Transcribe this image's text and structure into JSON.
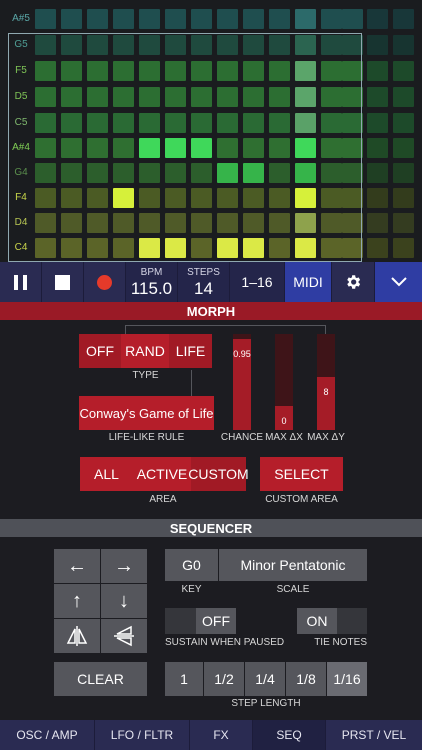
{
  "grid": {
    "note_labels": [
      {
        "text": "A#5",
        "color": "#5aa7a7"
      },
      {
        "text": "G5",
        "color": "#4f9e95"
      },
      {
        "text": "F5",
        "color": "#7fc456"
      },
      {
        "text": "D5",
        "color": "#7fc456"
      },
      {
        "text": "C5",
        "color": "#7fb86e"
      },
      {
        "text": "A#4",
        "color": "#7fcd54"
      },
      {
        "text": "G4",
        "color": "#5b8f4d"
      },
      {
        "text": "F4",
        "color": "#c8d64a"
      },
      {
        "text": "D4",
        "color": "#b7c553"
      },
      {
        "text": "C4",
        "color": "#c9d44b"
      }
    ],
    "row_colors": [
      {
        "base": "#1f4e4f",
        "hi": "#2c6a6a",
        "dim": "#183739"
      },
      {
        "base": "#1f4a3e",
        "hi": "#2b6450",
        "dim": "#173430"
      },
      {
        "base": "#2c6e32",
        "hi": "#5ba56a",
        "dim": "#1d4a2a"
      },
      {
        "base": "#2c6e32",
        "hi": "#5ba56a",
        "dim": "#1d4a2a"
      },
      {
        "base": "#2a6a34",
        "hi": "#5aa168",
        "dim": "#1d4a2a"
      },
      {
        "base": "#2f6f31",
        "hi": "#3fd85a",
        "dim": "#1f4a26"
      },
      {
        "base": "#2c5e2c",
        "hi": "#36b44a",
        "dim": "#1f3f23"
      },
      {
        "base": "#4b5b24",
        "hi": "#d6f03a",
        "dim": "#333c1c"
      },
      {
        "base": "#4f5a28",
        "hi": "#8ea24c",
        "dim": "#343c20"
      },
      {
        "base": "#5b6428",
        "hi": "#dbe946",
        "dim": "#3b421d"
      }
    ],
    "active_cells": [
      [
        5,
        4
      ],
      [
        5,
        5
      ],
      [
        5,
        6
      ],
      [
        6,
        7
      ],
      [
        6,
        8
      ],
      [
        7,
        3
      ],
      [
        9,
        4
      ],
      [
        9,
        5
      ],
      [
        9,
        7
      ],
      [
        9,
        8
      ]
    ],
    "highlight_column": 10
  },
  "transport": {
    "bpm_label": "BPM",
    "bpm_value": "115.0",
    "steps_label": "STEPS",
    "steps_value": "14",
    "range": "1–16",
    "midi": "MIDI"
  },
  "morph": {
    "title": "MORPH",
    "type_options": [
      "OFF",
      "RAND",
      "LIFE"
    ],
    "type_label": "TYPE",
    "rule_value": "Conway's Game of Life",
    "rule_label": "LIFE-LIKE RULE",
    "sliders": [
      {
        "label": "CHANCE",
        "value": "0.95",
        "fraction": 0.95
      },
      {
        "label": "MAX ΔX",
        "value": "0",
        "fraction": 0.25
      },
      {
        "label": "MAX ΔY",
        "value": "8",
        "fraction": 0.55
      }
    ],
    "area_options": [
      "ALL",
      "ACTIVE",
      "CUSTOM"
    ],
    "area_label": "AREA",
    "select_label": "SELECT",
    "custom_area_label": "CUSTOM AREA"
  },
  "sequencer": {
    "title": "SEQUENCER",
    "key_value": "G0",
    "key_label": "KEY",
    "scale_value": "Minor Pentatonic",
    "scale_label": "SCALE",
    "sustain_value": "OFF",
    "sustain_label": "SUSTAIN WHEN PAUSED",
    "tie_value": "ON",
    "tie_label": "TIE NOTES",
    "clear_label": "CLEAR",
    "step_lengths": [
      "1",
      "1/2",
      "1/4",
      "1/8",
      "1/16"
    ],
    "step_length_label": "STEP LENGTH"
  },
  "tabs": [
    "OSC / AMP",
    "LFO / FLTR",
    "FX",
    "SEQ",
    "PRST / VEL"
  ],
  "active_tab": "SEQ"
}
